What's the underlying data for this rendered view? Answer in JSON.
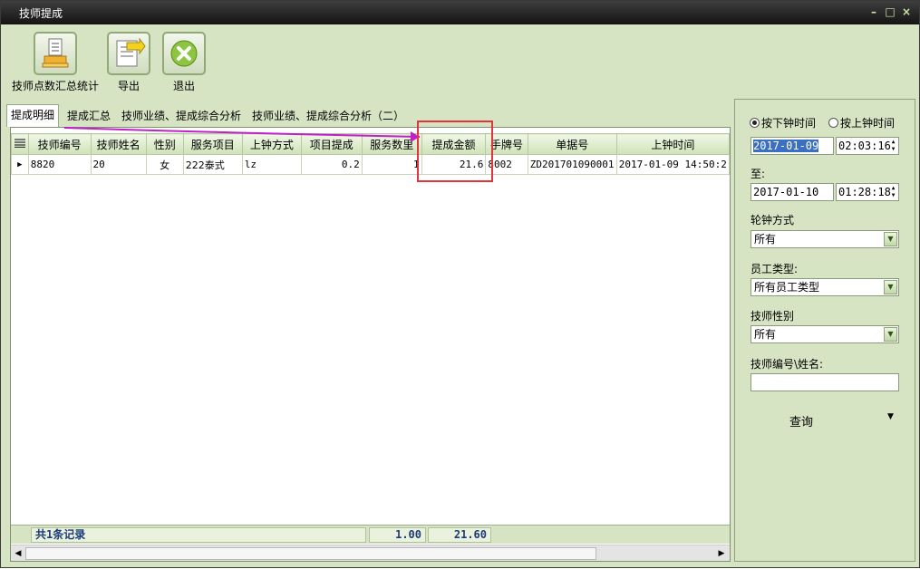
{
  "window": {
    "title": "技师提成",
    "min": "–",
    "max": "□",
    "close": "×"
  },
  "toolbar": {
    "stats": "技师点数汇总统计",
    "export": "导出",
    "exit": "退出"
  },
  "tabs": [
    {
      "label": "提成明细"
    },
    {
      "label": "提成汇总"
    },
    {
      "label": "技师业绩、提成综合分析"
    },
    {
      "label": "技师业绩、提成综合分析（二）"
    }
  ],
  "grid": {
    "columns": [
      "技师编号",
      "技师姓名",
      "性别",
      "服务项目",
      "上钟方式",
      "项目提成",
      "服务数里",
      "提成金额",
      "手牌号",
      "单据号",
      "上钟时间"
    ],
    "rows": [
      [
        "8820",
        "20",
        "女",
        "222泰式",
        "lz",
        "0.2",
        "1",
        "21.6",
        "8002",
        "ZD201701090001",
        "2017-01-09 14:50:2"
      ]
    ],
    "footer": {
      "count": "共1条记录",
      "qty_total": "1.00",
      "amount_total": "21.60"
    }
  },
  "sidebar": {
    "radio_off_time": "按下钟时间",
    "radio_on_time": "按上钟时间",
    "from_date": "2017-01-09",
    "from_time": "02:03:16",
    "to_label": "至:",
    "to_date": "2017-01-10",
    "to_time": "01:28:18",
    "rotation_label": "轮钟方式",
    "rotation_value": "所有",
    "staff_type_label": "员工类型:",
    "staff_type_value": "所有员工类型",
    "gender_label": "技师性别",
    "gender_value": "所有",
    "id_name_label": "技师编号\\姓名:",
    "id_name_value": "",
    "query_button": "查询"
  },
  "colors": {
    "window_bg": "#d6e4c4",
    "highlight": "#e0353a",
    "arrow": "#c020c8"
  }
}
